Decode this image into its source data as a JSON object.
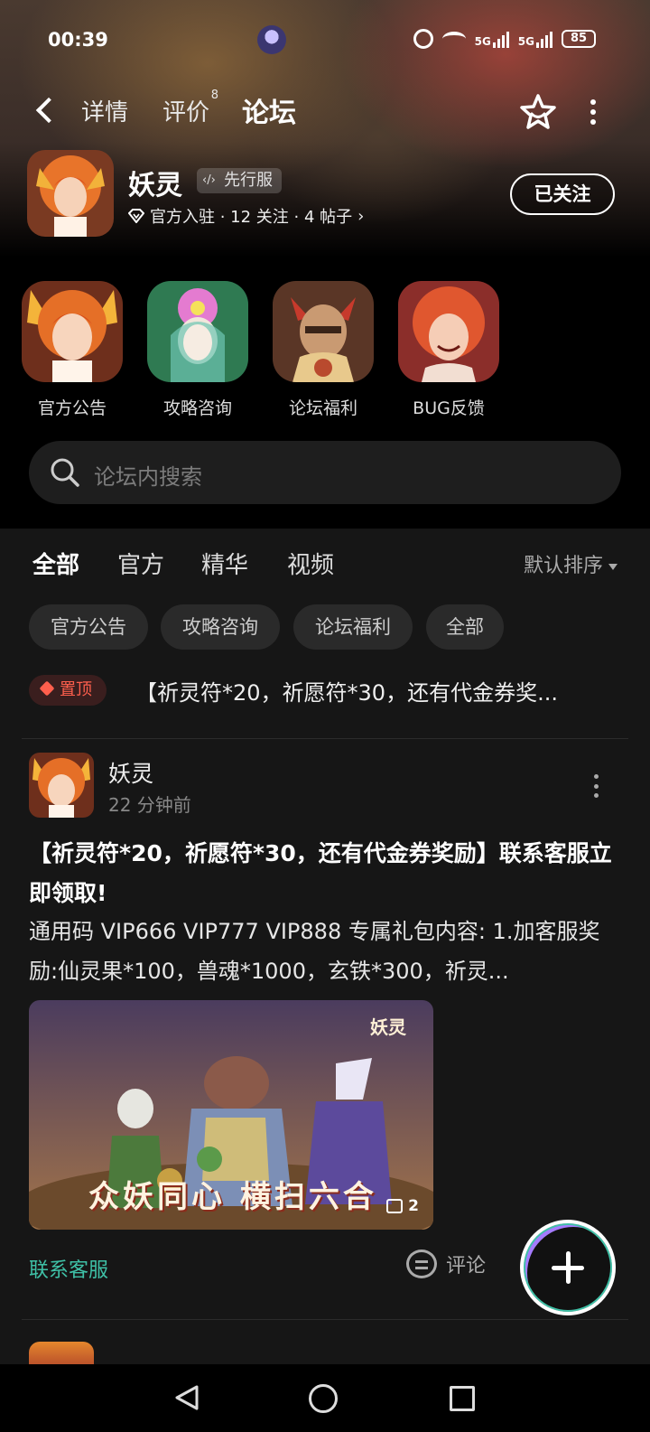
{
  "status_bar": {
    "time": "00:39",
    "network_1": "5G",
    "network_2": "5G",
    "battery": "85"
  },
  "nav": {
    "tab_detail": "详情",
    "tab_review": "评价",
    "review_count": "8",
    "tab_forum": "论坛"
  },
  "game": {
    "name": "妖灵",
    "badge": "先行服",
    "meta": "官方入驻 · 12 关注 · 4 帖子",
    "follow_label": "已关注"
  },
  "categories": [
    {
      "label": "官方公告",
      "icon": "fire-fox-girl-art"
    },
    {
      "label": "攻略咨询",
      "icon": "flower-fairy-art"
    },
    {
      "label": "论坛福利",
      "icon": "demon-warrior-art"
    },
    {
      "label": "BUG反馈",
      "icon": "red-hair-girl-art"
    }
  ],
  "search": {
    "placeholder": "论坛内搜索"
  },
  "feed_tabs": [
    "全部",
    "官方",
    "精华",
    "视频"
  ],
  "sort_label": "默认排序",
  "chips": [
    "官方公告",
    "攻略咨询",
    "论坛福利",
    "全部"
  ],
  "pinned": {
    "tag": "置顶",
    "text": "【祈灵符*20，祈愿符*30，还有代金券奖..."
  },
  "post": {
    "author": "妖灵",
    "time": "22 分钟前",
    "title": "【祈灵符*20，祈愿符*30，还有代金券奖励】联系客服立即领取!",
    "body": "通用码 VIP666 VIP777 VIP888 专属礼包内容: 1.加客服奖励:仙灵果*100，兽魂*1000，玄铁*300，祈灵...",
    "image_logo": "妖灵",
    "image_caption": "众妖同心 横扫六合",
    "image_count": "2",
    "contact_label": "联系客服",
    "comment_label": "评论"
  },
  "colors": {
    "accent": "#3fc1a7",
    "pin": "#ff5f4d",
    "background": "#161616"
  }
}
